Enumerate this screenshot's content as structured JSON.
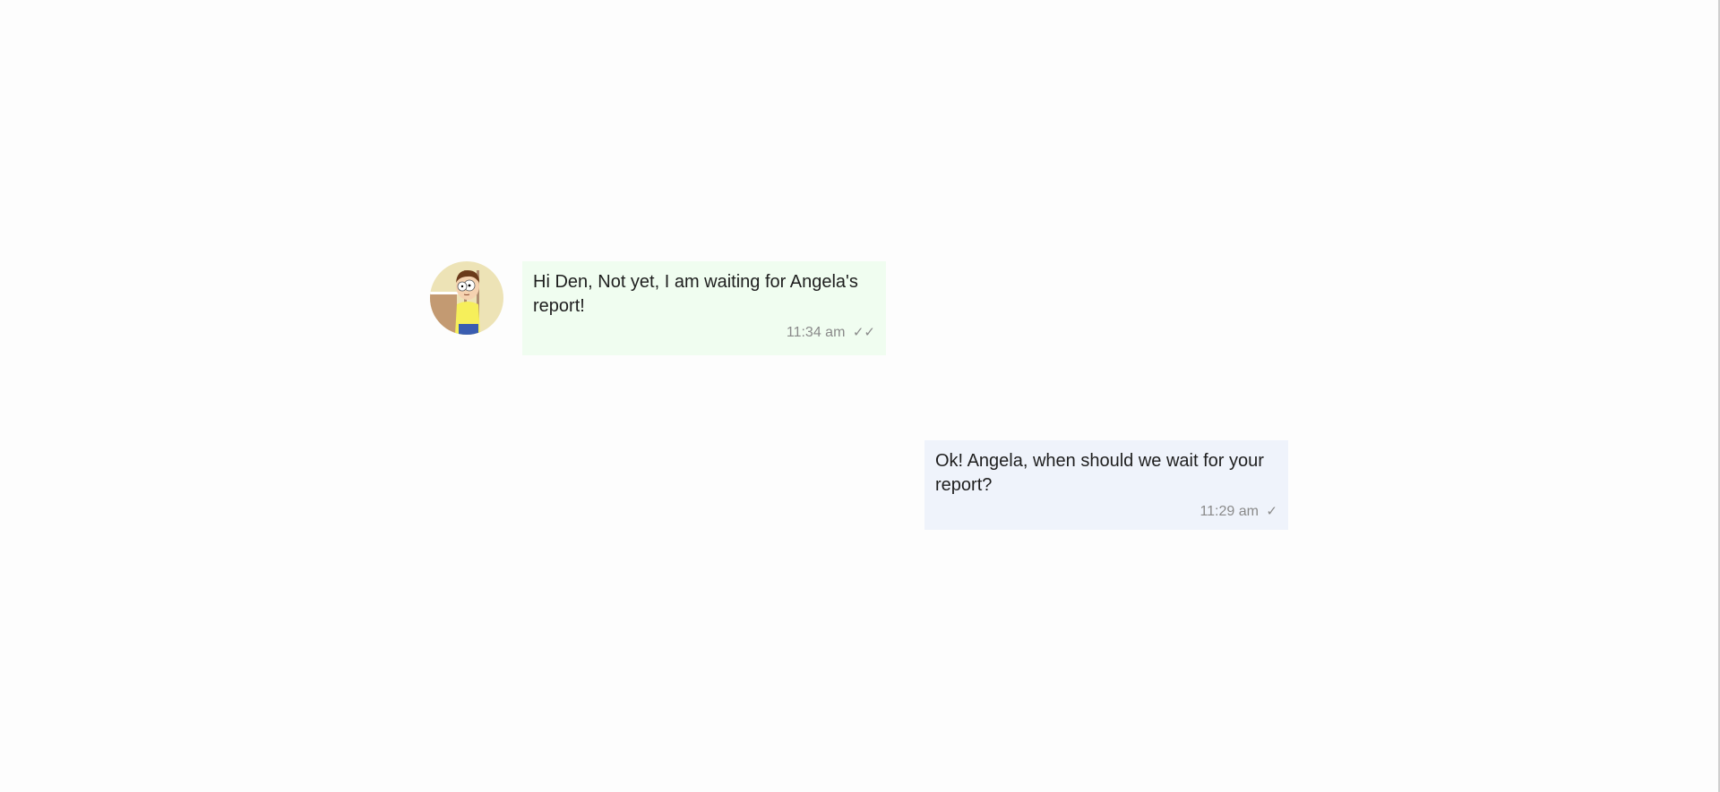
{
  "messages": [
    {
      "direction": "incoming",
      "text": "Hi Den, Not yet, I am waiting for Angela's report!",
      "time": "11:34 am",
      "status_icon": "double-check-icon",
      "status_glyph": "✓✓"
    },
    {
      "direction": "outgoing",
      "text": "Ok! Angela, when should we wait for your report?",
      "time": "11:29 am",
      "status_icon": "single-check-icon",
      "status_glyph": "✓"
    }
  ],
  "avatar": {
    "icon": "cartoon-character-avatar"
  },
  "colors": {
    "incoming_bubble": "#f0fdf0",
    "outgoing_bubble": "#eff3fb",
    "meta_text": "#8a8a8a",
    "message_text": "#1e1e1e"
  }
}
